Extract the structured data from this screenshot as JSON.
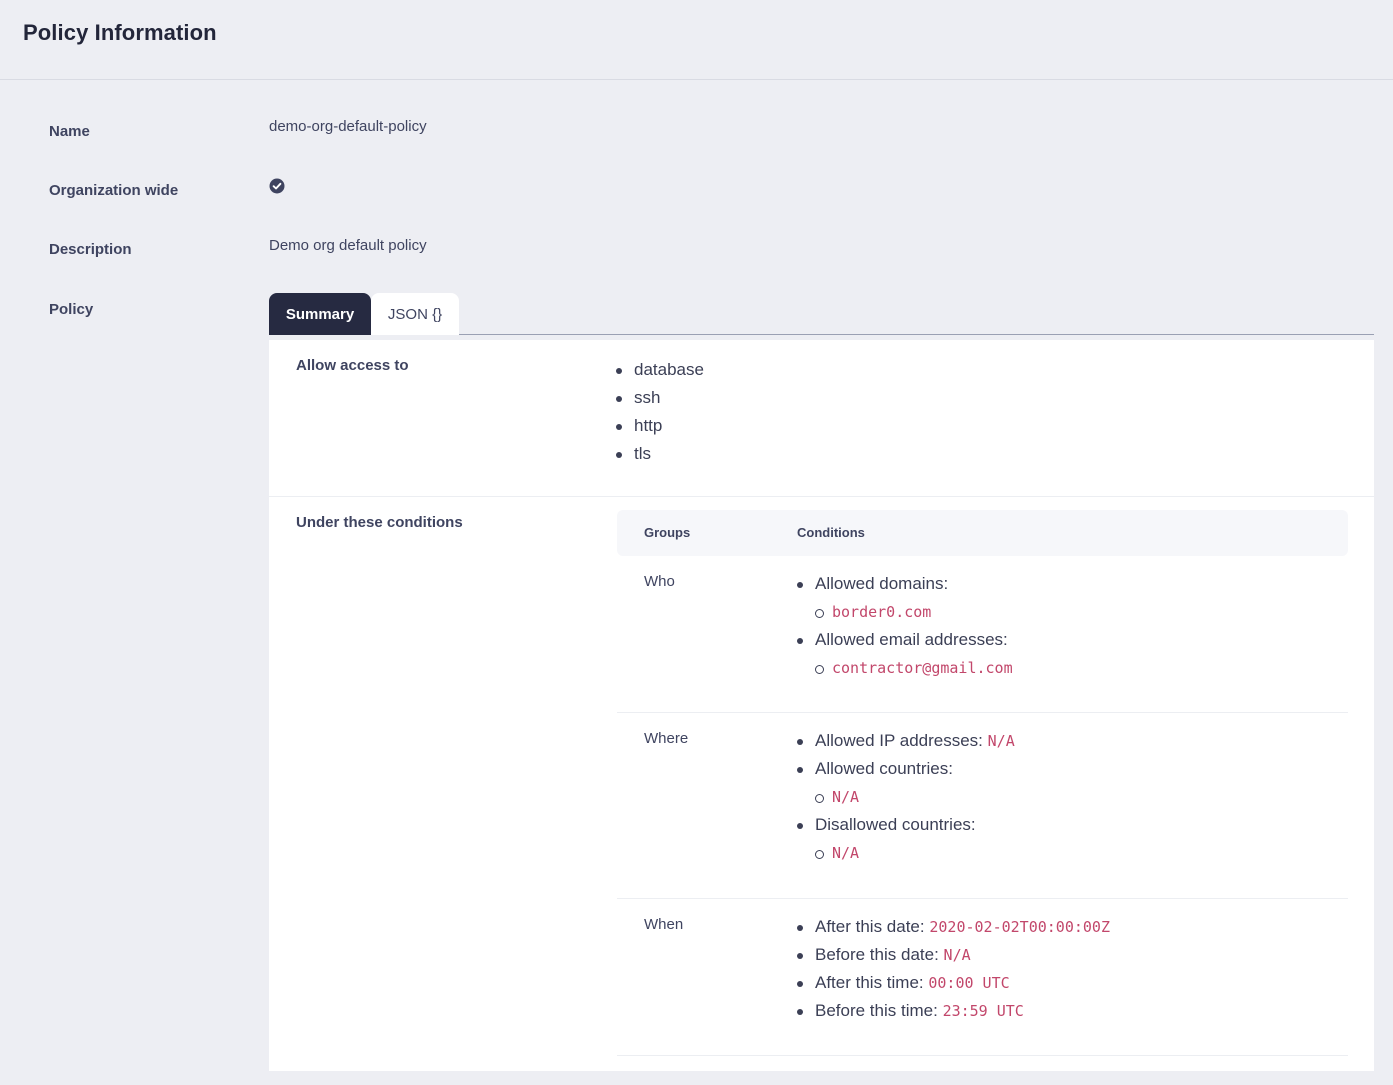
{
  "header": {
    "title": "Policy Information"
  },
  "fields": {
    "name_label": "Name",
    "name_value": "demo-org-default-policy",
    "org_wide_label": "Organization wide",
    "description_label": "Description",
    "description_value": "Demo org default policy",
    "policy_label": "Policy"
  },
  "tabs": [
    {
      "label": "Summary",
      "active": true
    },
    {
      "label": "JSON {}",
      "active": false
    }
  ],
  "summary": {
    "access_label": "Allow access to",
    "access_items": [
      "database",
      "ssh",
      "http",
      "tls"
    ],
    "conditions_label": "Under these conditions",
    "table": {
      "col_groups": "Groups",
      "col_conditions": "Conditions",
      "who": {
        "group": "Who",
        "allowed_domains_label": "Allowed domains:",
        "allowed_domains": [
          "border0.com"
        ],
        "allowed_emails_label": "Allowed email addresses:",
        "allowed_emails": [
          "contractor@gmail.com"
        ]
      },
      "where": {
        "group": "Where",
        "allowed_ips_label": "Allowed IP addresses:",
        "allowed_ips_value": "N/A",
        "allowed_countries_label": "Allowed countries:",
        "allowed_countries": [
          "N/A"
        ],
        "disallowed_countries_label": "Disallowed countries:",
        "disallowed_countries": [
          "N/A"
        ]
      },
      "when": {
        "group": "When",
        "after_date_label": "After this date:",
        "after_date_value": "2020-02-02T00:00:00Z",
        "before_date_label": "Before this date:",
        "before_date_value": "N/A",
        "after_time_label": "After this time:",
        "after_time_value": "00:00 UTC",
        "before_time_label": "Before this time:",
        "before_time_value": "23:59 UTC"
      }
    }
  },
  "colors": {
    "background": "#edeef3",
    "active_tab": "#262a41",
    "code_text": "#c2476b",
    "check_icon": "#3f4460"
  }
}
